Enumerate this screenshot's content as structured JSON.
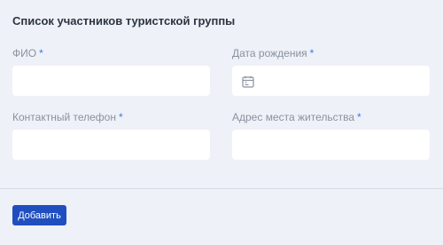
{
  "form": {
    "title": "Список участников туристской группы",
    "required_mark": "*",
    "fields": {
      "fio": {
        "label": "ФИО",
        "value": ""
      },
      "birth_date": {
        "label": "Дата рождения",
        "value": "",
        "icon": "calendar-icon"
      },
      "phone": {
        "label": "Контактный телефон",
        "value": ""
      },
      "address": {
        "label": "Адрес места жительства",
        "value": ""
      }
    },
    "add_button": {
      "label": "Добавить"
    }
  },
  "colors": {
    "background": "#eef1f7",
    "required": "#2f80ed",
    "button": "#1f4fbf"
  }
}
